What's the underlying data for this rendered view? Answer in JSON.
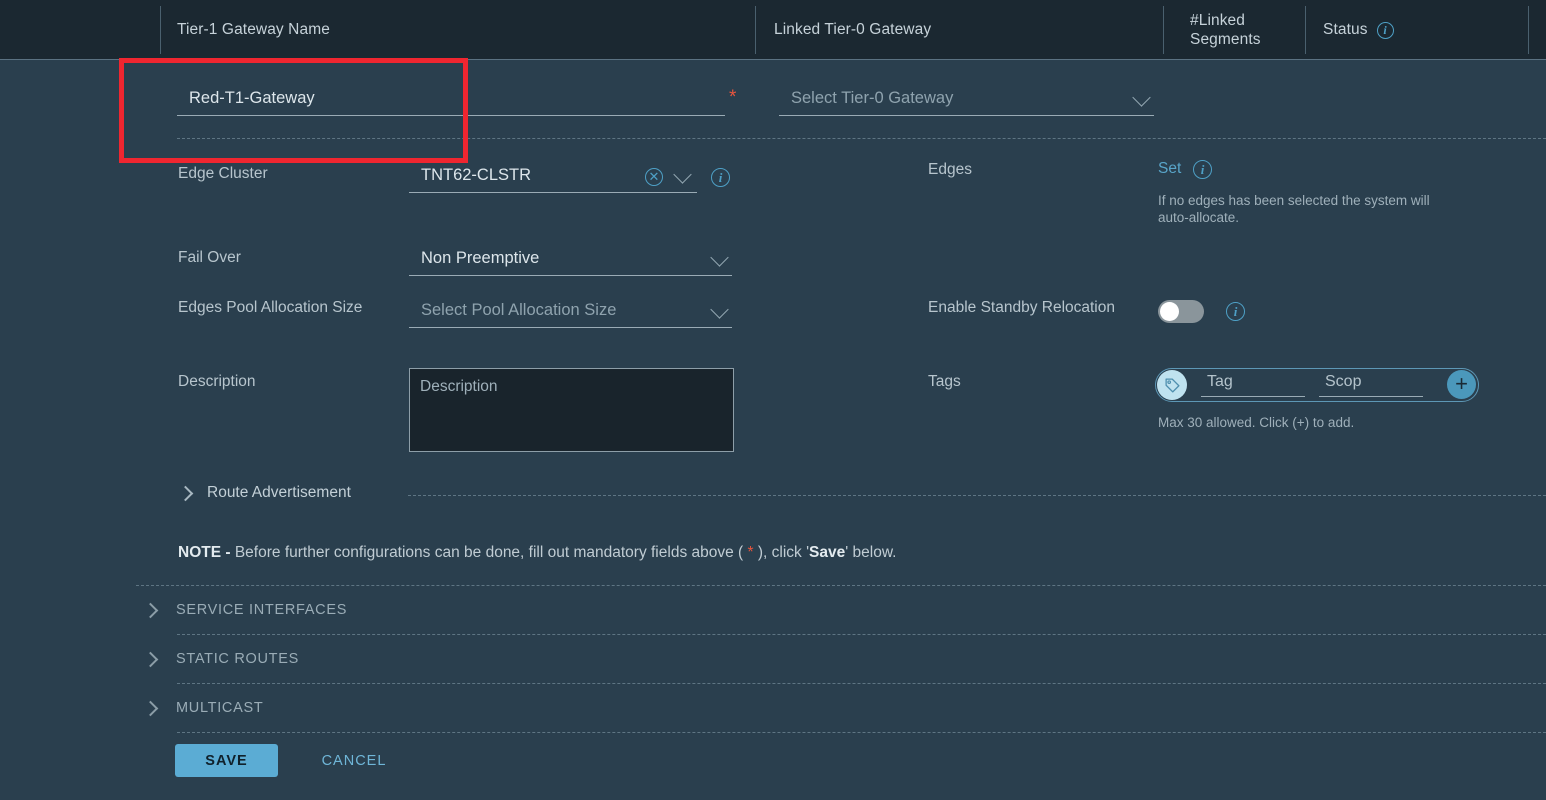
{
  "table_header": {
    "columns": [
      {
        "label": "Tier-1 Gateway Name"
      },
      {
        "label": "Linked Tier-0 Gateway"
      },
      {
        "label": "#Linked\nSegments"
      },
      {
        "label": "Status",
        "info": true
      }
    ]
  },
  "form": {
    "gateway_name": {
      "value": "Red-T1-Gateway",
      "required_marker": "*"
    },
    "linked_tier0": {
      "placeholder": "Select Tier-0 Gateway"
    },
    "edge_cluster": {
      "label": "Edge Cluster",
      "value": "TNT62-CLSTR"
    },
    "edges": {
      "label": "Edges",
      "action": "Set",
      "hint": "If no edges has been selected the system will auto-allocate."
    },
    "fail_over": {
      "label": "Fail Over",
      "value": "Non Preemptive"
    },
    "edges_pool": {
      "label": "Edges Pool Allocation Size",
      "placeholder": "Select Pool Allocation Size"
    },
    "standby_relocation": {
      "label": "Enable Standby Relocation",
      "state": "off"
    },
    "description": {
      "label": "Description",
      "placeholder": "Description"
    },
    "tags": {
      "label": "Tags",
      "tag_placeholder": "Tag",
      "scope_placeholder": "Scop",
      "hint": "Max 30 allowed. Click (+) to add.",
      "add_label": "+"
    },
    "route_advertisement": {
      "label": "Route Advertisement"
    },
    "note": {
      "prefix": "NOTE - ",
      "text_before_star": "Before further configurations can be done, fill out mandatory fields above ( ",
      "star": "*",
      "text_after_star": " ), click '",
      "save_word": "Save",
      "text_end": "' below."
    },
    "sections": [
      {
        "label": "SERVICE INTERFACES"
      },
      {
        "label": "STATIC ROUTES"
      },
      {
        "label": "MULTICAST"
      }
    ],
    "buttons": {
      "save": "SAVE",
      "cancel": "CANCEL"
    }
  },
  "colors": {
    "background": "#2a3f4e",
    "header_background": "#1b2831",
    "accent": "#5bacd4",
    "required": "#e8553e",
    "annotation": "#ef2630"
  }
}
